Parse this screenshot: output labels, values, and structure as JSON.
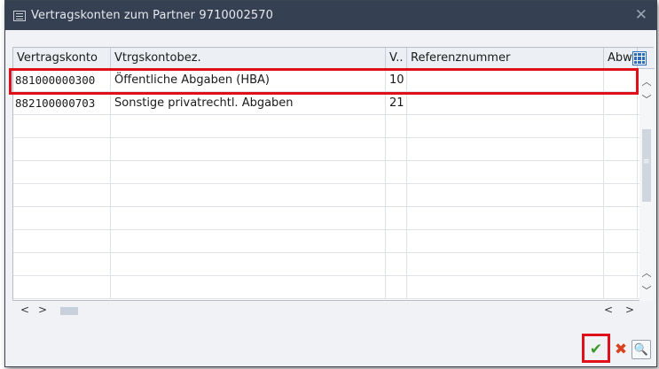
{
  "window": {
    "title": "Vertragskonten zum Partner 9710002570",
    "close_glyph": "✕"
  },
  "table": {
    "columns": [
      "Vertragskonto",
      "Vtrgskontobez.",
      "V..",
      "Referenznummer",
      "Abwe"
    ],
    "rows": [
      {
        "konto": "881000000300",
        "bez": "Öffentliche Abgaben (HBA)",
        "v": "10",
        "ref": "",
        "abw": ""
      },
      {
        "konto": "882100000703",
        "bez": "Sonstige privatrechtl. Abgaben",
        "v": "21",
        "ref": "",
        "abw": ""
      }
    ],
    "empty_rows": 8,
    "selected_row": 0
  },
  "icons": {
    "settings": "table-settings-icon",
    "ok": "checkmark-icon",
    "cancel": "cross-icon",
    "find": "binoculars-icon"
  },
  "colors": {
    "titlebar": "#354052",
    "highlight": "#e0101a",
    "ok": "#3a9b2c",
    "cancel": "#d9411f"
  }
}
